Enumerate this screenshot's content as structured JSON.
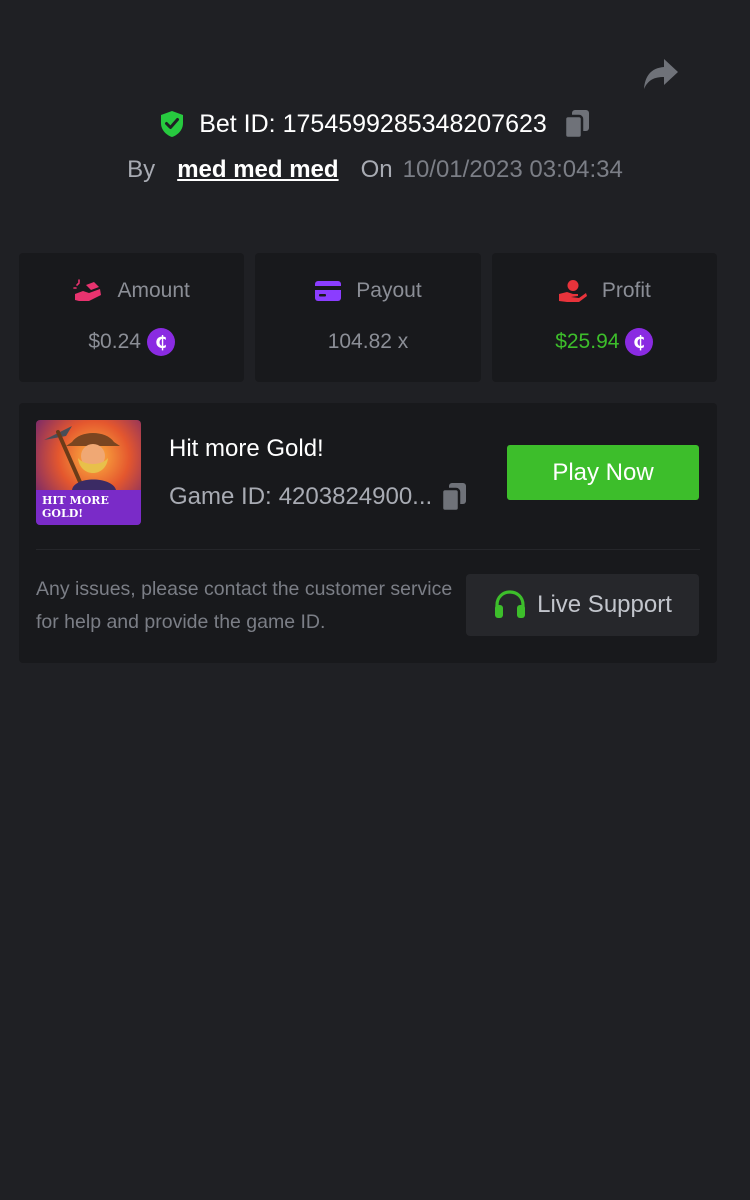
{
  "header": {
    "bet_id_label": "Bet ID:",
    "bet_id": "1754599285348207623",
    "by_label": "By",
    "username": "med med med",
    "on_label": "On",
    "datetime": "10/01/2023 03:04:34"
  },
  "stats": {
    "amount": {
      "label": "Amount",
      "value": "$0.24",
      "icon": "money-hand-icon"
    },
    "payout": {
      "label": "Payout",
      "value": "104.82 x",
      "icon": "card-icon"
    },
    "profit": {
      "label": "Profit",
      "value": "$25.94",
      "icon": "hand-coin-icon"
    }
  },
  "currency_symbol": "₵",
  "game": {
    "title": "Hit more Gold!",
    "id_label": "Game ID:",
    "id": "4203824900...",
    "thumb_text_line1": "HIT MORE",
    "thumb_text_line2": "GOLD!",
    "play_label": "Play Now"
  },
  "support": {
    "help_text": "Any issues, please contact the customer service for help and provide the game ID.",
    "button_label": "Live Support"
  },
  "colors": {
    "background": "#1f2024",
    "card": "#18191c",
    "accent_green": "#3dbe2b",
    "coin_purple": "#8a2be2",
    "amount_pink": "#e8336f",
    "payout_purple": "#8b3dff",
    "profit_red": "#e8333b"
  }
}
